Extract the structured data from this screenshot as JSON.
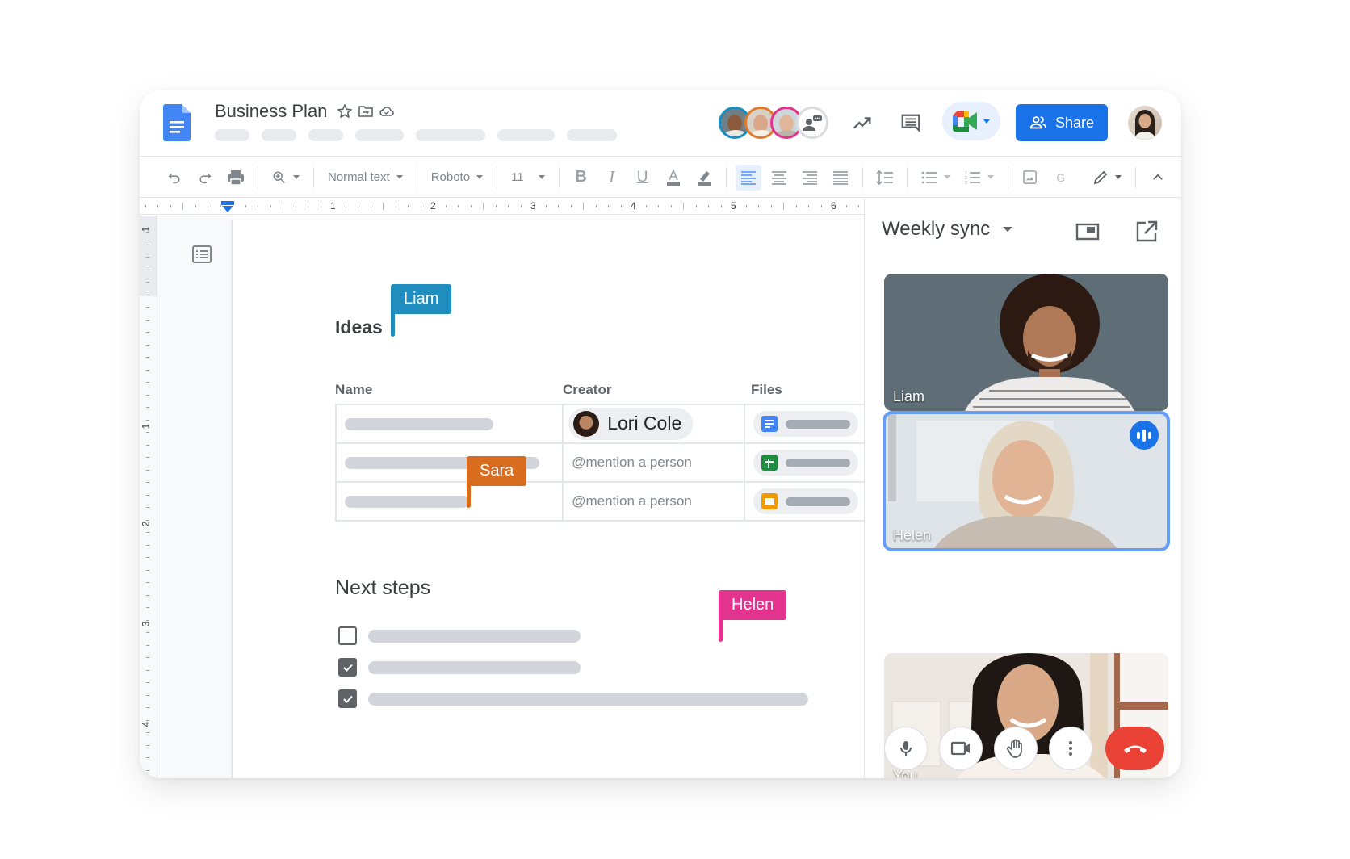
{
  "header": {
    "doc_title": "Business Plan",
    "title_icons": [
      "star-icon",
      "move-to-folder-icon",
      "cloud-saved-icon"
    ],
    "menu_placeholder_count": 8,
    "collaborators": [
      {
        "name": "Liam",
        "color": "#1a8ec0"
      },
      {
        "name": "Sara",
        "color": "#e07b2c"
      },
      {
        "name": "Helen",
        "color": "#e3338f"
      }
    ],
    "share_label": "Share",
    "brand_color": "#1a73e8"
  },
  "toolbar": {
    "style_select": "Normal text",
    "font_select": "Roboto",
    "size_select": "11"
  },
  "ruler": {
    "horizontal_numbers": [
      "1",
      "2",
      "3",
      "4",
      "5",
      "6"
    ],
    "vertical_numbers": [
      "1",
      "1",
      "2",
      "3",
      "4"
    ]
  },
  "document": {
    "heading_ideas": "Ideas",
    "heading_next_steps": "Next steps",
    "table": {
      "headers": [
        "Name",
        "Creator",
        "Files"
      ],
      "rows": [
        {
          "creator": "Lori Cole",
          "creator_type": "chip",
          "file_type": "docs"
        },
        {
          "creator": "@mention a person",
          "creator_type": "placeholder",
          "file_type": "sheets"
        },
        {
          "creator": "@mention a person",
          "creator_type": "placeholder",
          "file_type": "slides"
        }
      ]
    },
    "checklist": [
      {
        "checked": false
      },
      {
        "checked": true
      },
      {
        "checked": true
      }
    ],
    "cursors": [
      {
        "name": "Liam",
        "color": "#1f8dbd"
      },
      {
        "name": "Sara",
        "color": "#d96d1f"
      },
      {
        "name": "Helen",
        "color": "#e3338f"
      }
    ]
  },
  "meet": {
    "meeting_name": "Weekly sync",
    "participants": [
      {
        "name": "Liam",
        "speaking": false
      },
      {
        "name": "Helen",
        "speaking": true
      },
      {
        "name": "You",
        "speaking": false
      }
    ],
    "controls": [
      "microphone-icon",
      "camera-icon",
      "raise-hand-icon",
      "more-options-icon",
      "end-call-icon"
    ],
    "end_call_color": "#ea4335"
  }
}
